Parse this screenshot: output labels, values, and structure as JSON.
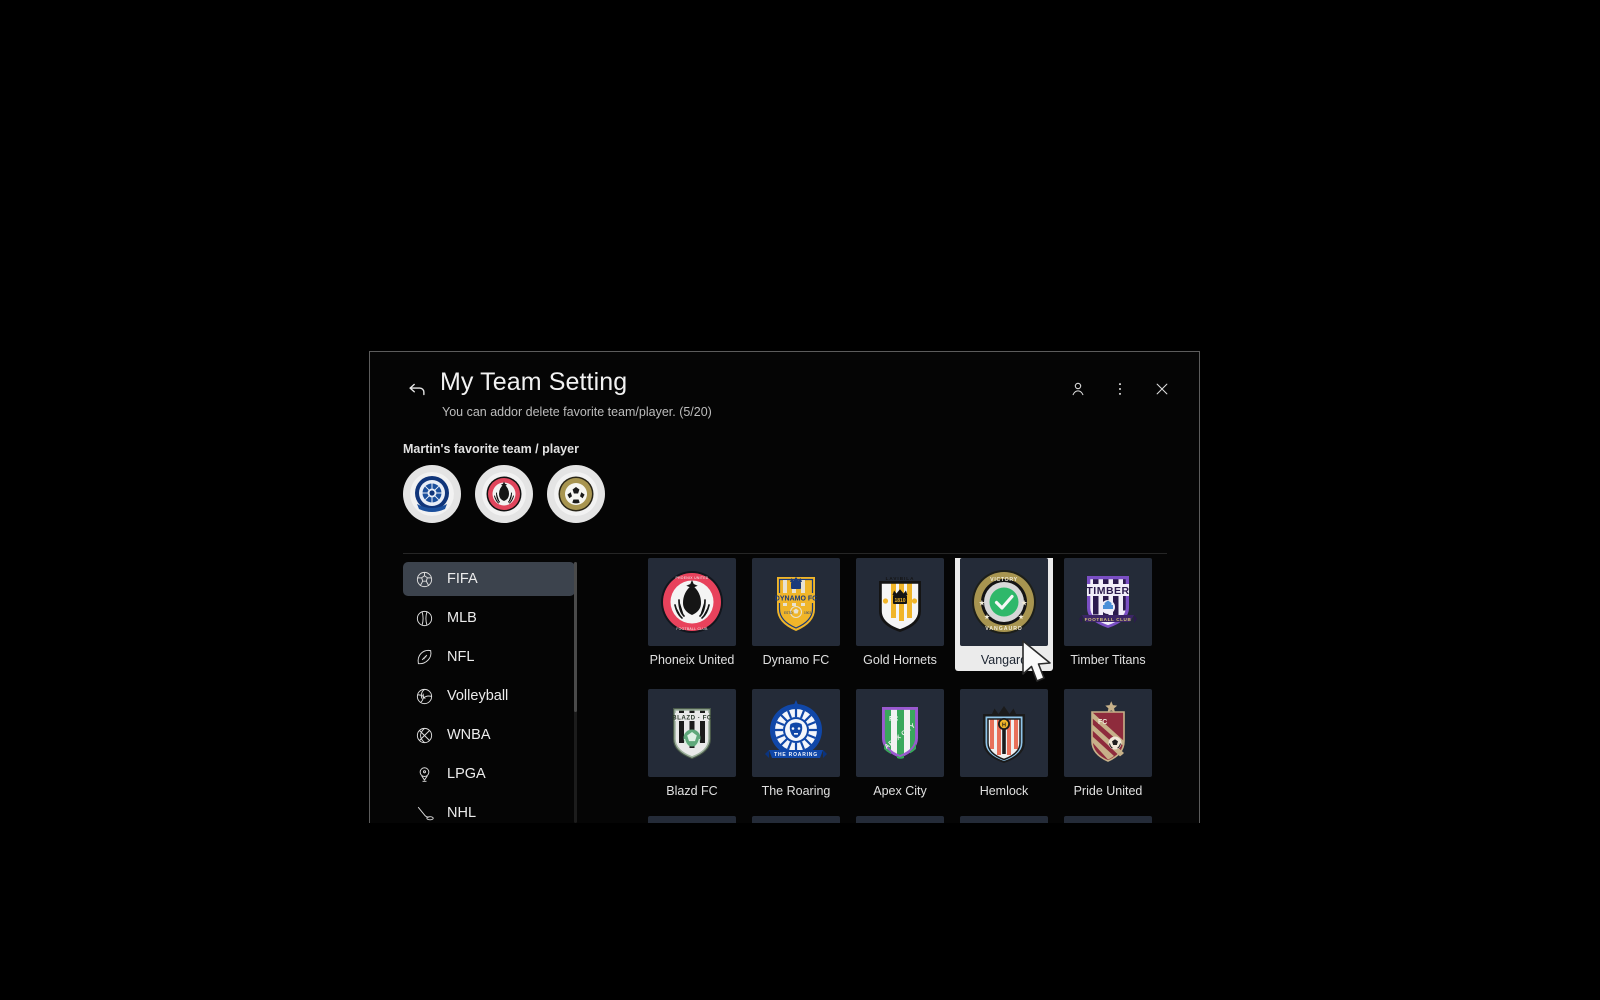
{
  "header": {
    "back_icon": "back-arrow-icon",
    "title": "My Team Setting",
    "subtitle": "You can addor delete favorite team/player. (5/20)",
    "actions": [
      {
        "name": "profile-icon",
        "label": "Profile"
      },
      {
        "name": "more-options-icon",
        "label": "More options"
      },
      {
        "name": "close-icon",
        "label": "Close"
      }
    ]
  },
  "favorites": {
    "label": "Martin's favorite team / player",
    "items": [
      {
        "name": "favorite-avatar-blue-crest",
        "accent": "#1b4f9c"
      },
      {
        "name": "favorite-avatar-red-crest",
        "accent": "#e0455c"
      },
      {
        "name": "favorite-avatar-gold-ball",
        "accent": "#a89550"
      }
    ]
  },
  "sidebar": {
    "items": [
      {
        "label": "FIFA",
        "icon": "soccer-ball-icon",
        "active": true
      },
      {
        "label": "MLB",
        "icon": "baseball-icon",
        "active": false
      },
      {
        "label": "NFL",
        "icon": "football-icon",
        "active": false
      },
      {
        "label": "Volleyball",
        "icon": "volleyball-icon",
        "active": false
      },
      {
        "label": "WNBA",
        "icon": "basketball-icon",
        "active": false
      },
      {
        "label": "LPGA",
        "icon": "golf-icon",
        "active": false
      },
      {
        "label": "NHL",
        "icon": "hockey-icon",
        "active": false
      }
    ]
  },
  "grid": {
    "rows": [
      [
        {
          "label": "Phoneix United",
          "logo": "phoenix-united-crest",
          "selected": false
        },
        {
          "label": "Dynamo FC",
          "logo": "dynamo-fc-crest",
          "selected": false
        },
        {
          "label": "Gold Hornets",
          "logo": "gold-hornets-crest",
          "selected": false
        },
        {
          "label": "Vangard",
          "logo": "vangard-crest",
          "selected": true
        },
        {
          "label": "Timber Titans",
          "logo": "timber-titans-crest",
          "selected": false
        }
      ],
      [
        {
          "label": "Blazd FC",
          "logo": "blazd-fc-crest",
          "selected": false
        },
        {
          "label": "The Roaring",
          "logo": "the-roaring-crest",
          "selected": false
        },
        {
          "label": "Apex City",
          "logo": "apex-city-crest",
          "selected": false
        },
        {
          "label": "Hemlock",
          "logo": "hemlock-crest",
          "selected": false
        },
        {
          "label": "Pride United",
          "logo": "pride-united-crest",
          "selected": false
        }
      ]
    ]
  },
  "colors": {
    "window_bg": "#050505",
    "tile_bg": "#242b38",
    "sidebar_active": "#3c434d",
    "selected_tile": "#ebebeb",
    "text_primary": "#f2f2f2",
    "text_secondary": "#bdbdbd"
  }
}
